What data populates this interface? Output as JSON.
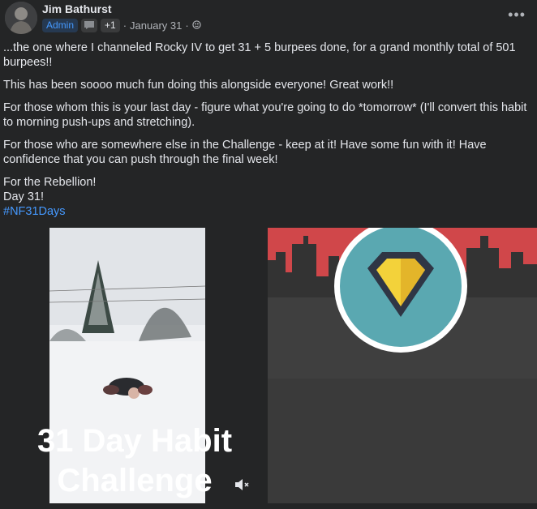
{
  "post": {
    "author": "Jim Bathurst",
    "role_badge": "Admin",
    "plus_count": "+1",
    "date": "January 31",
    "paragraphs": [
      "...the one where I channeled Rocky IV to get 31 + 5 burpees done, for a grand monthly total of 501 burpees!!",
      "This has been soooo much fun doing this alongside everyone! Great work!!",
      "For those whom this is your last day - figure what you're going to do *tomorrow* (I'll convert this habit to morning push-ups and stretching).",
      "For those who are somewhere else in the Challenge - keep at it! Have some fun with it! Have confidence that you can push through the final week!"
    ],
    "closing_line1": "For the Rebellion!",
    "closing_line2": "Day 31!",
    "hashtag": "#NF31Days"
  },
  "poster": {
    "line1": "31 Day Habit",
    "line2": "Challenge",
    "sky_color": "#d0474a",
    "badge_circle": "#5aa8b1",
    "gem_color": "#f3d23a"
  },
  "icons": {
    "more": "more-horizontal-icon",
    "mute": "speaker-muted-icon",
    "audience": "globe-icon"
  }
}
